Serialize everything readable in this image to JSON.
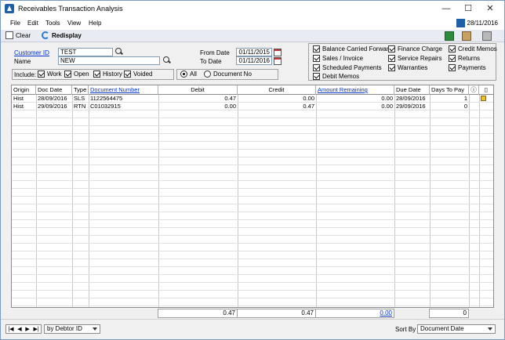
{
  "window": {
    "title": "Receivables Transaction Analysis",
    "controls": {
      "minimize": "—",
      "maximize": "☐",
      "close": "✕"
    }
  },
  "menu": {
    "items": [
      "File",
      "Edit",
      "Tools",
      "View",
      "Help"
    ],
    "date": "28/11/2016"
  },
  "toolbar": {
    "clear_label": "Clear",
    "redisplay_label": "Redisplay"
  },
  "form": {
    "customer_id_label": "Customer ID",
    "customer_id_value": "TEST",
    "name_label": "Name",
    "name_value": "NEW",
    "from_date_label": "From Date",
    "from_date_value": "01/11/2015",
    "to_date_label": "To Date",
    "to_date_value": "01/11/2016",
    "include_label": "Include:",
    "include": [
      {
        "label": "Work",
        "checked": true
      },
      {
        "label": "Open",
        "checked": true
      },
      {
        "label": "History",
        "checked": true
      },
      {
        "label": "Voided",
        "checked": true
      }
    ],
    "doc_filter": [
      {
        "label": "All",
        "selected": true
      },
      {
        "label": "Document No",
        "selected": false
      }
    ],
    "doc_types_col1": [
      {
        "label": "Balance Carried Forward",
        "checked": true
      },
      {
        "label": "Sales / Invoice",
        "checked": true
      },
      {
        "label": "Scheduled Payments",
        "checked": true
      },
      {
        "label": "Debit Memos",
        "checked": true
      }
    ],
    "doc_types_col2": [
      {
        "label": "Finance Charge",
        "checked": true
      },
      {
        "label": "Service Repairs",
        "checked": true
      },
      {
        "label": "Warranties",
        "checked": true
      }
    ],
    "doc_types_col3": [
      {
        "label": "Credit Memos",
        "checked": true
      },
      {
        "label": "Returns",
        "checked": true
      },
      {
        "label": "Payments",
        "checked": true
      }
    ]
  },
  "grid": {
    "headers": {
      "origin": "Origin",
      "doc_date": "Doc Date",
      "type": "Type",
      "doc_number": "Document Number",
      "debit": "Debit",
      "credit": "Credit",
      "amount_remaining": "Amount Remaining",
      "due_date": "Due Date",
      "days_to_pay": "Days To Pay"
    },
    "rows": [
      {
        "origin": "Hist",
        "doc_date": "28/09/2016",
        "type": "SLS",
        "doc_number": "1122564475",
        "debit": "0.47",
        "credit": "0.00",
        "amount_remaining": "0.00",
        "due_date": "28/09/2016",
        "days_to_pay": "1"
      },
      {
        "origin": "Hist",
        "doc_date": "29/09/2016",
        "type": "RTN",
        "doc_number": "C01032915",
        "debit": "0.00",
        "credit": "0.47",
        "amount_remaining": "0.00",
        "due_date": "29/09/2016",
        "days_to_pay": "0"
      }
    ],
    "totals": {
      "debit": "0.47",
      "credit": "0.47",
      "amount_remaining": "0.00",
      "days_to_pay": "0"
    }
  },
  "bottom": {
    "browse_by": "by Debtor ID",
    "sort_by_label": "Sort By",
    "sort_by_value": "Document Date"
  }
}
